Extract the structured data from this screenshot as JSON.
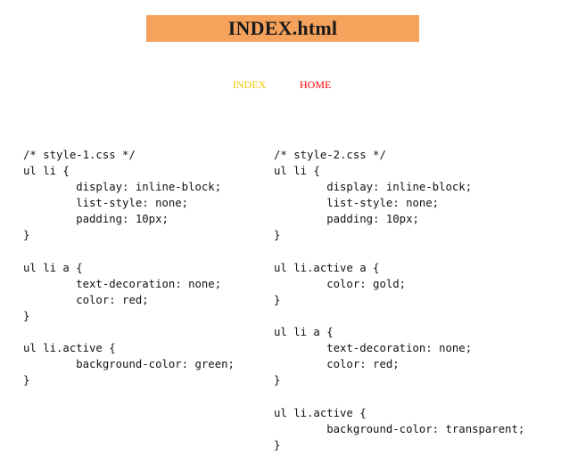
{
  "header": {
    "title": "INDEX.html"
  },
  "nav": {
    "items": [
      {
        "label": "INDEX",
        "color": "#f5c400",
        "active": true
      },
      {
        "label": "HOME",
        "color": "#ff0000",
        "active": false
      }
    ]
  },
  "code_blocks": [
    {
      "lines": [
        "/* style-1.css */",
        "ul li {",
        "        display: inline-block;",
        "        list-style: none;",
        "        padding: 10px;",
        "}",
        "",
        "ul li a {",
        "        text-decoration: none;",
        "        color: red;",
        "}",
        "",
        "ul li.active {",
        "        background-color: green;",
        "}"
      ]
    },
    {
      "lines": [
        "/* style-2.css */",
        "ul li {",
        "        display: inline-block;",
        "        list-style: none;",
        "        padding: 10px;",
        "}",
        "",
        "ul li.active a {",
        "        color: gold;",
        "}",
        "",
        "ul li a {",
        "        text-decoration: none;",
        "        color: red;",
        "}",
        "",
        "ul li.active {",
        "        background-color: transparent;",
        "}"
      ]
    }
  ]
}
